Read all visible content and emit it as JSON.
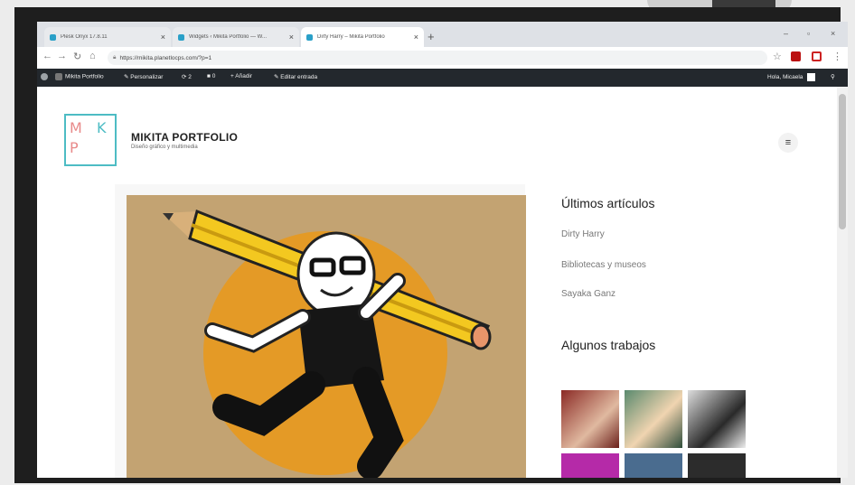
{
  "browser": {
    "tabs": [
      {
        "title": "Plesk Onyx 17.8.11"
      },
      {
        "title": "Widgets ‹ Mikita Portfolio — W..."
      },
      {
        "title": "Dirty Harry – Mikita Portfolio"
      }
    ],
    "url": "https://mikita.planetlocps.com/?p=1",
    "colors": {
      "accent": "#2aa0c8",
      "adminbar": "#23282d"
    }
  },
  "adminbar": {
    "site_name": "Mikita Portfolio",
    "customize": "Personalizar",
    "updates": "2",
    "comments": "0",
    "new": "Añadir",
    "edit": "Editar entrada",
    "greeting": "Hola, Micaela"
  },
  "site": {
    "logo_letters": [
      "M",
      "K",
      "P"
    ],
    "title": "MIKITA PORTFOLIO",
    "description": "Diseño gráfico y multimedia"
  },
  "sidebar": {
    "recent_heading": "Últimos artículos",
    "recent_posts": [
      "Dirty Harry",
      "Bibliotecas y museos",
      "Sayaka Ganz"
    ],
    "works_heading": "Algunos trabajos"
  }
}
